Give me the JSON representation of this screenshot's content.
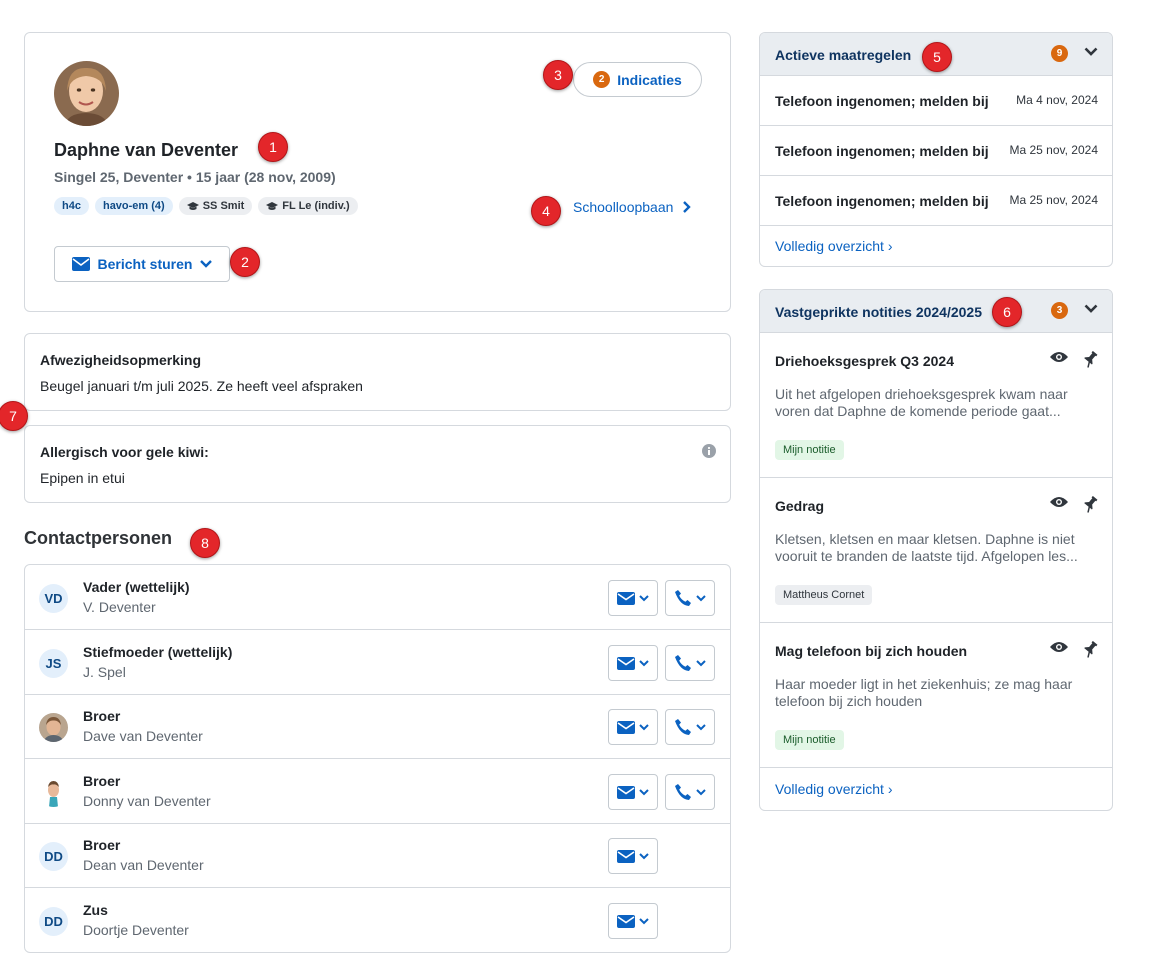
{
  "profile": {
    "name": "Daphne van Deventer",
    "meta": "Singel 25, Deventer • 15 jaar (28 nov, 2009)",
    "tags": [
      "h4c",
      "havo-em (4)",
      "SS Smit",
      "FL Le (indiv.)"
    ],
    "message_button": "Bericht sturen",
    "indications_count": "2",
    "indications_label": "Indicaties",
    "school_career_link": "Schoolloopbaan"
  },
  "notes": {
    "absence_title": "Afwezigheidsopmerking",
    "absence_text": "Beugel januari t/m juli 2025. Ze heeft veel afspraken",
    "allergy_title": "Allergisch voor gele kiwi:",
    "allergy_text": "Epipen in etui"
  },
  "contacts": {
    "title": "Contactpersonen",
    "rows": [
      {
        "initials": "VD",
        "role": "Vader (wettelijk)",
        "name": "V. Deventer"
      },
      {
        "initials": "JS",
        "role": "Stiefmoeder (wettelijk)",
        "name": "J. Spel"
      },
      {
        "initials": "",
        "role": "Broer",
        "name": "Dave van Deventer"
      },
      {
        "initials": "",
        "role": "Broer",
        "name": "Donny van Deventer"
      },
      {
        "initials": "DD",
        "role": "Broer",
        "name": "Dean van Deventer"
      },
      {
        "initials": "DD",
        "role": "Zus",
        "name": "Doortje Deventer"
      }
    ]
  },
  "measures": {
    "title": "Actieve maatregelen",
    "count": "9",
    "items": [
      {
        "text": "Telefoon ingenomen; melden bij",
        "date": "Ma 4 nov, 2024"
      },
      {
        "text": "Telefoon ingenomen; melden bij",
        "date": "Ma 25 nov, 2024"
      },
      {
        "text": "Telefoon ingenomen; melden bij",
        "date": "Ma 25 nov, 2024"
      }
    ],
    "link": "Volledig overzicht ›"
  },
  "pinned": {
    "title": "Vastgeprikte notities 2024/2025",
    "count": "3",
    "items": [
      {
        "title": "Driehoeksgesprek Q3 2024",
        "text": "Uit het afgelopen driehoeksgesprek kwam naar voren dat Daphne de komende periode gaat...",
        "tag": "Mijn notitie"
      },
      {
        "title": "Gedrag",
        "text": "Kletsen, kletsen en maar kletsen. Daphne is niet vooruit te branden de laatste tijd. Afgelopen les...",
        "tag": "Mattheus Cornet"
      },
      {
        "title": "Mag telefoon bij zich houden",
        "text": "Haar moeder ligt in het ziekenhuis; ze mag haar telefoon bij zich houden",
        "tag": "Mijn notitie"
      }
    ],
    "link": "Volledig overzicht ›"
  },
  "markers": [
    "1",
    "2",
    "3",
    "4",
    "5",
    "6",
    "7",
    "8"
  ],
  "colors": {
    "accent": "#0b62c1",
    "badge": "#d9680f",
    "marker": "#e3262a"
  }
}
